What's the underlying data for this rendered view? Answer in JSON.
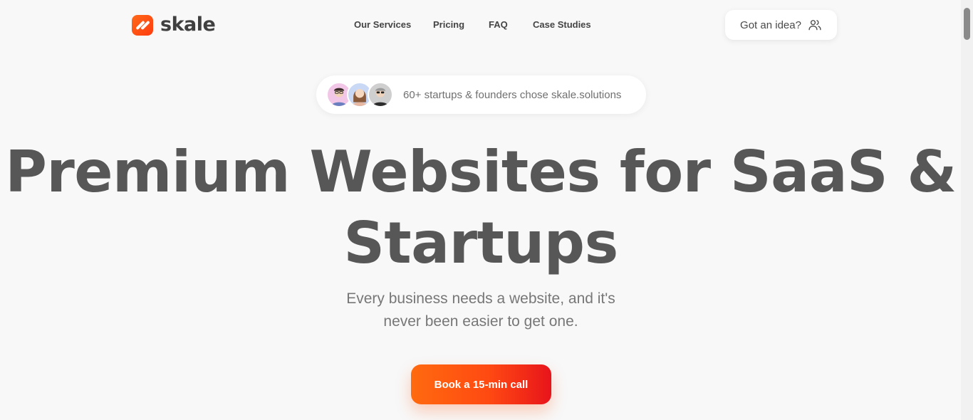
{
  "header": {
    "logo_text": "skale",
    "nav": [
      {
        "label": "Our Services"
      },
      {
        "label": "Pricing"
      },
      {
        "label": "FAQ"
      },
      {
        "label": "Case Studies"
      }
    ],
    "idea_button": "Got an idea?"
  },
  "badge": {
    "text": "60+ startups & founders chose skale.solutions"
  },
  "hero": {
    "title": "Premium Websites for SaaS & Startups",
    "subtitle_line1": "Every business needs a website, and it's",
    "subtitle_line2": "never been easier to get one.",
    "cta_label": "Book a 15-min call"
  },
  "colors": {
    "accent_start": "#ff6a0f",
    "accent_end": "#e8141b",
    "background": "#f8f8f8",
    "heading": "#575757"
  },
  "icons": {
    "logo": "skale-logo-icon",
    "idea_button": "users-icon"
  }
}
